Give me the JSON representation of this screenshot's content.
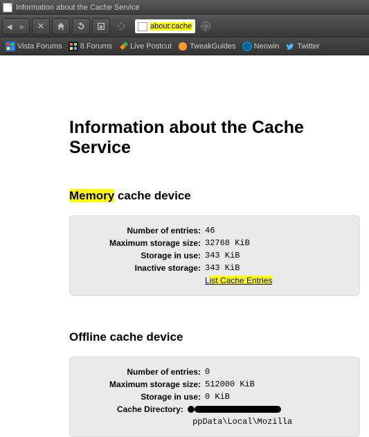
{
  "window": {
    "title": "Information about the Cache Service"
  },
  "address": {
    "url": "about:cache"
  },
  "bookmarks": [
    {
      "id": "vista",
      "label": "Vista Forums"
    },
    {
      "id": "eight",
      "label": "8 Forums"
    },
    {
      "id": "postcut",
      "label": "Live Postcut"
    },
    {
      "id": "tweak",
      "label": "TweakGuides"
    },
    {
      "id": "neowin",
      "label": "Neowin"
    },
    {
      "id": "twitter",
      "label": "Twitter"
    }
  ],
  "page": {
    "h1": "Information about the Cache Service",
    "memory": {
      "heading_hl": "Memory",
      "heading_rest": " cache device",
      "entries_label": "Number of entries:",
      "entries_value": "46",
      "max_label": "Maximum storage size:",
      "max_value": "32768 KiB",
      "inuse_label": "Storage in use:",
      "inuse_value": "343 KiB",
      "inactive_label": "Inactive storage:",
      "inactive_value": "343 KiB",
      "link_first": "L",
      "link_hl": "ist Cache Entries"
    },
    "offline": {
      "heading": "Offline cache device",
      "entries_label": "Number of entries:",
      "entries_value": "0",
      "max_label": "Maximum storage size:",
      "max_value": "512000 KiB",
      "inuse_label": "Storage in use:",
      "inuse_value": "0 KiB",
      "dir_label": "Cache Directory:",
      "dir_suffix": "ppData\\Local\\Mozilla"
    }
  }
}
